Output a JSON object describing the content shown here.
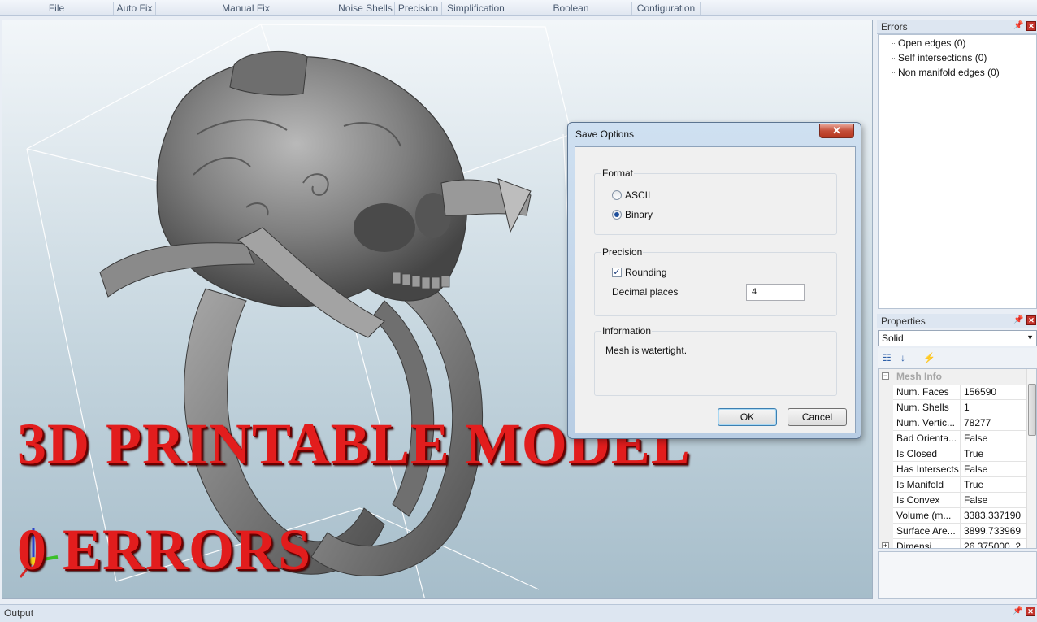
{
  "ribbon": {
    "groups": [
      "File",
      "Auto Fix",
      "Manual Fix",
      "Noise Shells",
      "Precision",
      "Simplification",
      "Boolean",
      "Configuration"
    ]
  },
  "viewport": {
    "overlay_line1": "3D PRINTABLE MODEL",
    "overlay_line2": "0 ERRORS"
  },
  "dialog": {
    "title": "Save Options",
    "close_symbol": "✕",
    "format_group": "Format",
    "format_options": [
      "ASCII",
      "Binary"
    ],
    "format_selected": "Binary",
    "precision_group": "Precision",
    "rounding_label": "Rounding",
    "rounding_checked": true,
    "decimal_label": "Decimal places",
    "decimal_value": "4",
    "info_group": "Information",
    "info_text": "Mesh is watertight.",
    "ok_label": "OK",
    "cancel_label": "Cancel"
  },
  "errors_panel": {
    "title": "Errors",
    "items": [
      "Open edges (0)",
      "Self intersections (0)",
      "Non manifold edges (0)"
    ]
  },
  "properties_panel": {
    "title": "Properties",
    "object_selected": "Solid",
    "category": "Mesh Info",
    "rows": [
      {
        "key": "Num. Faces",
        "value": "156590"
      },
      {
        "key": "Num. Shells",
        "value": "1"
      },
      {
        "key": "Num. Vertic...",
        "value": "78277"
      },
      {
        "key": "Bad Orienta...",
        "value": "False"
      },
      {
        "key": "Is Closed",
        "value": "True"
      },
      {
        "key": "Has Intersects",
        "value": "False"
      },
      {
        "key": "Is Manifold",
        "value": "True"
      },
      {
        "key": "Is Convex",
        "value": "False"
      },
      {
        "key": "Volume (m...",
        "value": "3383.337190"
      },
      {
        "key": "Surface Are...",
        "value": "3899.733969"
      },
      {
        "key": "Dimensi...",
        "value": "26.375000, 2..."
      }
    ]
  },
  "output_panel": {
    "title": "Output"
  },
  "colors": {
    "overlay_red": "#e21d1d",
    "close_red": "#c44d37",
    "viewport_top": "#f2f6f9",
    "viewport_bottom": "#a6bdca"
  }
}
